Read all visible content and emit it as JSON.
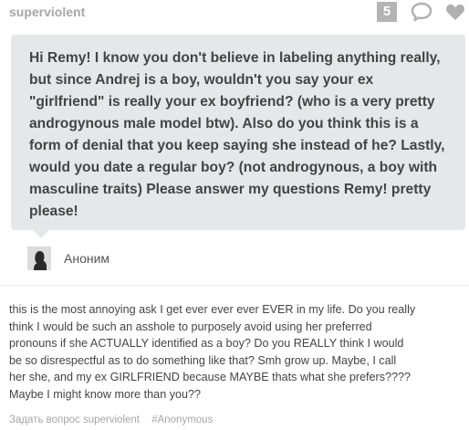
{
  "header": {
    "username": "superviolent",
    "notes_count": "5",
    "reply_icon": "speech-bubble-icon",
    "like_icon": "heart-icon"
  },
  "ask": {
    "text": "Hi Remy! I know you don't believe in labeling anything really, but since Andrej is a boy, wouldn't you say your ex \"girlfriend\" is really your ex boyfriend? (who is a very pretty androgynous male model btw). Also do you think this is a form of denial that you keep saying she instead of he? Lastly, would you date a regular boy? (not androgynous, a boy with masculine traits) Please answer my questions Remy! pretty please!",
    "asker_name": "Аноним",
    "avatar_icon": "anonymous-silhouette-icon"
  },
  "answer": {
    "lines": [
      "this is the most annoying ask I get ever ever ever EVER in my life. Do you really",
      "think I would be such an asshole to purposely avoid using her preferred",
      "pronouns if she ACTUALLY identified as a boy? Do you REALLY think I would",
      "be so disrespectful as to do something like that? Smh grow up. Maybe, I call",
      "her she, and my ex GIRLFRIEND because MAYBE thats what she prefers????",
      "Maybe I might know more than you??"
    ]
  },
  "footer": {
    "ask_link": "Задать вопрос superviolent",
    "tag": "#Anonymous"
  },
  "colors": {
    "bubble": "#e5e7e9",
    "muted": "#a7a7a7",
    "text": "#444444"
  }
}
